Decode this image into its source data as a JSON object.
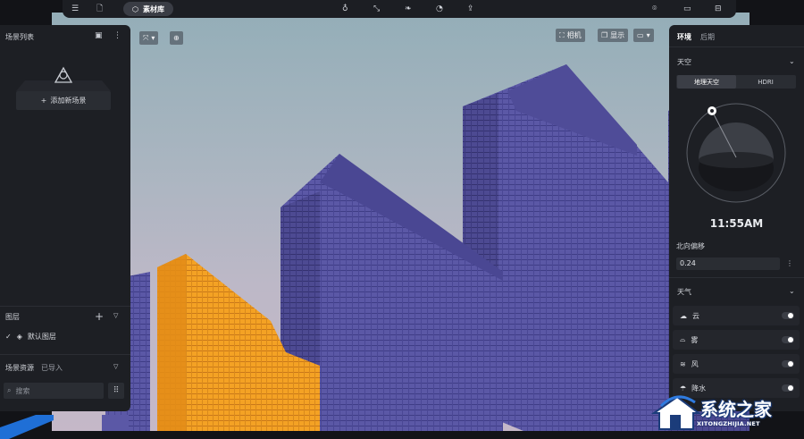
{
  "toolbar": {
    "library_label": "素材库",
    "icons": [
      "menu-icon",
      "file-icon",
      "cube-icon",
      "bulb-icon",
      "path-icon",
      "leaf-icon",
      "timer-icon",
      "export-icon",
      "camera-icon",
      "video-icon",
      "save-icon"
    ]
  },
  "left_panel": {
    "scene_list_title": "场景列表",
    "add_scene_label": "添加新场景",
    "layers_title": "图层",
    "default_layer": "默认图层",
    "assets_title": "场景资源",
    "imported_tab": "已导入",
    "search_placeholder": "搜索"
  },
  "viewport": {
    "camera_label": "相机",
    "display_label": "显示"
  },
  "right_panel": {
    "tab_environment": "环境",
    "tab_post": "后期",
    "sky_section": "天空",
    "sky_modes": [
      "地理天空",
      "HDRI"
    ],
    "active_sky_mode": "地理天空",
    "time": "11:55AM",
    "north_offset_label": "北向偏移",
    "north_offset_value": "0.24",
    "weather_section": "天气",
    "weather_items": [
      {
        "label": "云",
        "icon": "cloud-icon",
        "enabled": false
      },
      {
        "label": "雾",
        "icon": "fog-icon",
        "enabled": false
      },
      {
        "label": "风",
        "icon": "wind-icon",
        "enabled": false
      },
      {
        "label": "降水",
        "icon": "rain-icon",
        "enabled": false
      }
    ]
  },
  "watermark": {
    "brand": "系统之家",
    "url": "XITONGZHIJIA.NET"
  },
  "colors": {
    "panel_bg": "#1d1f24",
    "building_purple": "#5d5aa8",
    "building_orange": "#f29a1c",
    "sky": "#a9b5c0"
  }
}
